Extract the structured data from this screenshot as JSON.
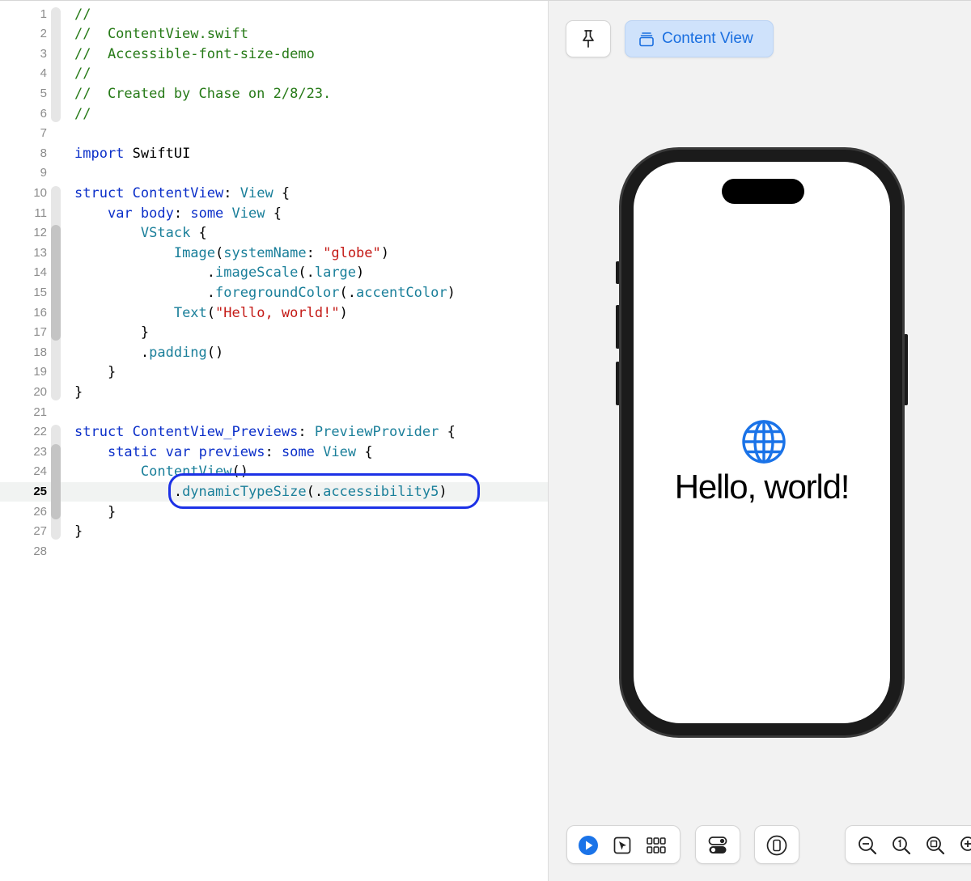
{
  "editor": {
    "lines": [
      {
        "n": "1",
        "tokens": [
          {
            "t": "//",
            "c": "comment"
          }
        ]
      },
      {
        "n": "2",
        "tokens": [
          {
            "t": "//  ContentView.swift",
            "c": "comment"
          }
        ]
      },
      {
        "n": "3",
        "tokens": [
          {
            "t": "//  Accessible-font-size-demo",
            "c": "comment"
          }
        ]
      },
      {
        "n": "4",
        "tokens": [
          {
            "t": "//",
            "c": "comment"
          }
        ]
      },
      {
        "n": "5",
        "tokens": [
          {
            "t": "//  Created by Chase on 2/8/23.",
            "c": "comment"
          }
        ]
      },
      {
        "n": "6",
        "tokens": [
          {
            "t": "//",
            "c": "comment"
          }
        ]
      },
      {
        "n": "7",
        "tokens": []
      },
      {
        "n": "8",
        "tokens": [
          {
            "t": "import",
            "c": "kw"
          },
          {
            "t": " SwiftUI",
            "c": "plain"
          }
        ]
      },
      {
        "n": "9",
        "tokens": []
      },
      {
        "n": "10",
        "tokens": [
          {
            "t": "struct",
            "c": "kw"
          },
          {
            "t": " ContentView",
            "c": "kw"
          },
          {
            "t": ": ",
            "c": "plain"
          },
          {
            "t": "View",
            "c": "type"
          },
          {
            "t": " {",
            "c": "plain"
          }
        ]
      },
      {
        "n": "11",
        "tokens": [
          {
            "t": "    ",
            "c": "plain"
          },
          {
            "t": "var",
            "c": "kw"
          },
          {
            "t": " body",
            "c": "kw"
          },
          {
            "t": ": ",
            "c": "plain"
          },
          {
            "t": "some",
            "c": "kw"
          },
          {
            "t": " View",
            "c": "type"
          },
          {
            "t": " {",
            "c": "plain"
          }
        ]
      },
      {
        "n": "12",
        "tokens": [
          {
            "t": "        ",
            "c": "plain"
          },
          {
            "t": "VStack",
            "c": "type"
          },
          {
            "t": " {",
            "c": "plain"
          }
        ]
      },
      {
        "n": "13",
        "tokens": [
          {
            "t": "            ",
            "c": "plain"
          },
          {
            "t": "Image",
            "c": "type"
          },
          {
            "t": "(",
            "c": "plain"
          },
          {
            "t": "systemName",
            "c": "type"
          },
          {
            "t": ": ",
            "c": "plain"
          },
          {
            "t": "\"globe\"",
            "c": "str"
          },
          {
            "t": ")",
            "c": "plain"
          }
        ]
      },
      {
        "n": "14",
        "tokens": [
          {
            "t": "                .",
            "c": "plain"
          },
          {
            "t": "imageScale",
            "c": "type"
          },
          {
            "t": "(.",
            "c": "plain"
          },
          {
            "t": "large",
            "c": "type"
          },
          {
            "t": ")",
            "c": "plain"
          }
        ]
      },
      {
        "n": "15",
        "tokens": [
          {
            "t": "                .",
            "c": "plain"
          },
          {
            "t": "foregroundColor",
            "c": "type"
          },
          {
            "t": "(.",
            "c": "plain"
          },
          {
            "t": "accentColor",
            "c": "type"
          },
          {
            "t": ")",
            "c": "plain"
          }
        ]
      },
      {
        "n": "16",
        "tokens": [
          {
            "t": "            ",
            "c": "plain"
          },
          {
            "t": "Text",
            "c": "type"
          },
          {
            "t": "(",
            "c": "plain"
          },
          {
            "t": "\"Hello, world!\"",
            "c": "str"
          },
          {
            "t": ")",
            "c": "plain"
          }
        ]
      },
      {
        "n": "17",
        "tokens": [
          {
            "t": "        }",
            "c": "plain"
          }
        ]
      },
      {
        "n": "18",
        "tokens": [
          {
            "t": "        .",
            "c": "plain"
          },
          {
            "t": "padding",
            "c": "type"
          },
          {
            "t": "()",
            "c": "plain"
          }
        ]
      },
      {
        "n": "19",
        "tokens": [
          {
            "t": "    }",
            "c": "plain"
          }
        ]
      },
      {
        "n": "20",
        "tokens": [
          {
            "t": "}",
            "c": "plain"
          }
        ]
      },
      {
        "n": "21",
        "tokens": []
      },
      {
        "n": "22",
        "tokens": [
          {
            "t": "struct",
            "c": "kw"
          },
          {
            "t": " ContentView_Previews",
            "c": "kw"
          },
          {
            "t": ": ",
            "c": "plain"
          },
          {
            "t": "PreviewProvider",
            "c": "type"
          },
          {
            "t": " {",
            "c": "plain"
          }
        ]
      },
      {
        "n": "23",
        "tokens": [
          {
            "t": "    ",
            "c": "plain"
          },
          {
            "t": "static",
            "c": "kw"
          },
          {
            "t": " var",
            "c": "kw"
          },
          {
            "t": " previews",
            "c": "kw"
          },
          {
            "t": ": ",
            "c": "plain"
          },
          {
            "t": "some",
            "c": "kw"
          },
          {
            "t": " View",
            "c": "type"
          },
          {
            "t": " {",
            "c": "plain"
          }
        ]
      },
      {
        "n": "24",
        "tokens": [
          {
            "t": "        ",
            "c": "plain"
          },
          {
            "t": "ContentView",
            "c": "type"
          },
          {
            "t": "()",
            "c": "plain"
          }
        ]
      },
      {
        "n": "25",
        "tokens": [
          {
            "t": "            .",
            "c": "plain"
          },
          {
            "t": "dynamicTypeSize",
            "c": "type"
          },
          {
            "t": "(.",
            "c": "plain"
          },
          {
            "t": "accessibility5",
            "c": "type"
          },
          {
            "t": ")",
            "c": "plain"
          }
        ],
        "current": true
      },
      {
        "n": "26",
        "tokens": [
          {
            "t": "    }",
            "c": "plain"
          }
        ]
      },
      {
        "n": "27",
        "tokens": [
          {
            "t": "}",
            "c": "plain"
          }
        ]
      },
      {
        "n": "28",
        "tokens": []
      }
    ]
  },
  "preview": {
    "pin_icon": "pin-icon",
    "content_view_icon": "stacked-pages-icon",
    "content_view_label": "Content View",
    "phone": {
      "globe_icon": "globe-icon",
      "text": "Hello, world!",
      "accent_color": "#1a73e8"
    },
    "bottom_toolbar": {
      "icons": [
        "live-play-icon",
        "select-cursor-icon",
        "variants-grid-icon",
        "device-settings-icon",
        "device-icon",
        "zoom-out-icon",
        "zoom-actual-size-icon",
        "zoom-to-fit-icon",
        "zoom-in-icon"
      ]
    }
  },
  "colors": {
    "comment": "#267a17",
    "keyword": "#0b2fc9",
    "type": "#1a7f9a",
    "string": "#c41a16",
    "highlight_ring": "#1c31e6",
    "accent": "#1a73e8"
  }
}
